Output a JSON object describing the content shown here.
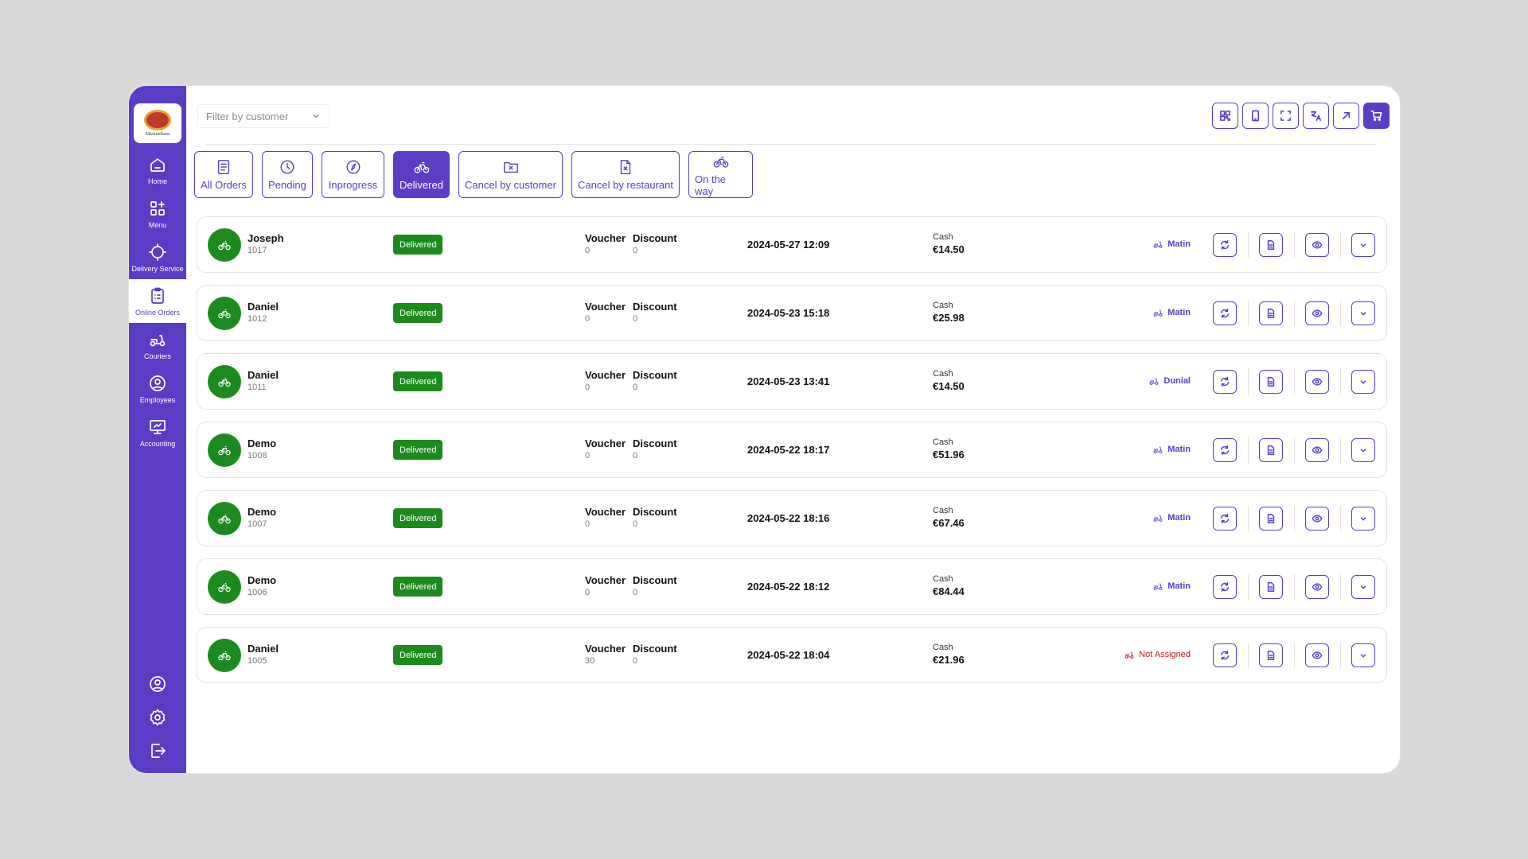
{
  "brand": {
    "logo_text": "Maximilians"
  },
  "sidebar": {
    "items": [
      {
        "label": "Home",
        "icon": "home-icon"
      },
      {
        "label": "Menu",
        "icon": "grid-plus-icon"
      },
      {
        "label": "Delivery Service",
        "icon": "target-icon"
      },
      {
        "label": "Online Orders",
        "icon": "clipboard-icon",
        "active": true
      },
      {
        "label": "Couriers",
        "icon": "scooter-icon"
      },
      {
        "label": "Employees",
        "icon": "user-circle-icon"
      },
      {
        "label": "Accounting",
        "icon": "presentation-icon"
      }
    ],
    "bottom_icons": [
      "profile-icon",
      "settings-icon",
      "logout-icon"
    ]
  },
  "filter": {
    "placeholder": "Filter by customer"
  },
  "toolbar": [
    "qr-icon",
    "tablet-icon",
    "fullscreen-icon",
    "translate-icon",
    "external-link-icon",
    "cart-icon"
  ],
  "tabs": [
    {
      "label": "All Orders",
      "icon": "list-icon"
    },
    {
      "label": "Pending",
      "icon": "clock-icon"
    },
    {
      "label": "Inprogress",
      "icon": "compass-icon"
    },
    {
      "label": "Delivered",
      "icon": "bicycle-icon",
      "active": true
    },
    {
      "label": "Cancel by customer",
      "icon": "folder-x-icon"
    },
    {
      "label": "Cancel by restaurant",
      "icon": "file-x-icon"
    },
    {
      "label": "On the way",
      "icon": "bicycle-icon"
    }
  ],
  "labels": {
    "voucher": "Voucher",
    "discount": "Discount"
  },
  "orders": [
    {
      "name": "Joseph",
      "id": "1017",
      "status": "Delivered",
      "voucher": "0",
      "discount": "0",
      "date": "2024-05-27 12:09",
      "payment": "Cash",
      "amount": "€14.50",
      "courier": "Matin",
      "assigned": true
    },
    {
      "name": "Daniel",
      "id": "1012",
      "status": "Delivered",
      "voucher": "0",
      "discount": "0",
      "date": "2024-05-23 15:18",
      "payment": "Cash",
      "amount": "€25.98",
      "courier": "Matin",
      "assigned": true
    },
    {
      "name": "Daniel",
      "id": "1011",
      "status": "Delivered",
      "voucher": "0",
      "discount": "0",
      "date": "2024-05-23 13:41",
      "payment": "Cash",
      "amount": "€14.50",
      "courier": "Dunial",
      "assigned": true
    },
    {
      "name": "Demo",
      "id": "1008",
      "status": "Delivered",
      "voucher": "0",
      "discount": "0",
      "date": "2024-05-22 18:17",
      "payment": "Cash",
      "amount": "€51.96",
      "courier": "Matin",
      "assigned": true
    },
    {
      "name": "Demo",
      "id": "1007",
      "status": "Delivered",
      "voucher": "0",
      "discount": "0",
      "date": "2024-05-22 18:16",
      "payment": "Cash",
      "amount": "€67.46",
      "courier": "Matin",
      "assigned": true
    },
    {
      "name": "Demo",
      "id": "1006",
      "status": "Delivered",
      "voucher": "0",
      "discount": "0",
      "date": "2024-05-22 18:12",
      "payment": "Cash",
      "amount": "€84.44",
      "courier": "Matin",
      "assigned": true
    },
    {
      "name": "Daniel",
      "id": "1005",
      "status": "Delivered",
      "voucher": "30",
      "discount": "0",
      "date": "2024-05-22 18:04",
      "payment": "Cash",
      "amount": "€21.96",
      "courier": "Not Assigned",
      "assigned": false
    }
  ],
  "colors": {
    "accent": "#5b3cc4",
    "delivered": "#1d8a1d",
    "unassigned": "#b22222"
  }
}
